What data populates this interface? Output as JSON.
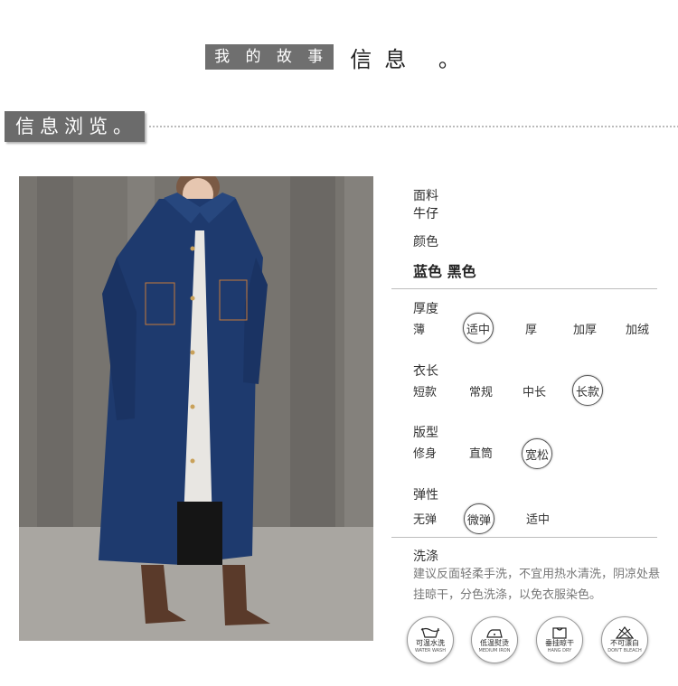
{
  "banner": {
    "tag": "我 的 故 事",
    "title": "信息 。"
  },
  "section": {
    "title": "信息浏览。"
  },
  "product_photo": {
    "alt": "denim long coat model"
  },
  "specs": {
    "fabric": {
      "label": "面料",
      "value": "牛仔"
    },
    "color": {
      "label": "颜色",
      "value": "蓝色 黑色"
    },
    "thickness": {
      "label": "厚度",
      "options": [
        "薄",
        "适中",
        "厚",
        "加厚",
        "加绒"
      ],
      "selected": "适中"
    },
    "length": {
      "label": "衣长",
      "options": [
        "短款",
        "常规",
        "中长",
        "长款"
      ],
      "selected": "长款"
    },
    "fit": {
      "label": "版型",
      "options": [
        "修身",
        "直筒",
        "宽松"
      ],
      "selected": "宽松"
    },
    "elasticity": {
      "label": "弹性",
      "options": [
        "无弹",
        "微弹",
        "适中"
      ],
      "selected": "微弹"
    },
    "washing": {
      "label": "洗涤",
      "text": "建议反面轻柔手洗，不宜用热水清洗，阴凉处悬挂晾干，分色洗涤，以免衣服染色。"
    }
  },
  "care_icons": [
    {
      "name": "wash-icon",
      "label": "可温水洗",
      "sub": "WATER WASH"
    },
    {
      "name": "iron-icon",
      "label": "低温熨烫",
      "sub": "MEDIUM IRON"
    },
    {
      "name": "hang-dry-icon",
      "label": "垂挂晾干",
      "sub": "HANG DRY"
    },
    {
      "name": "no-bleach-icon",
      "label": "不可漂白",
      "sub": "DON'T BLEACH"
    }
  ]
}
